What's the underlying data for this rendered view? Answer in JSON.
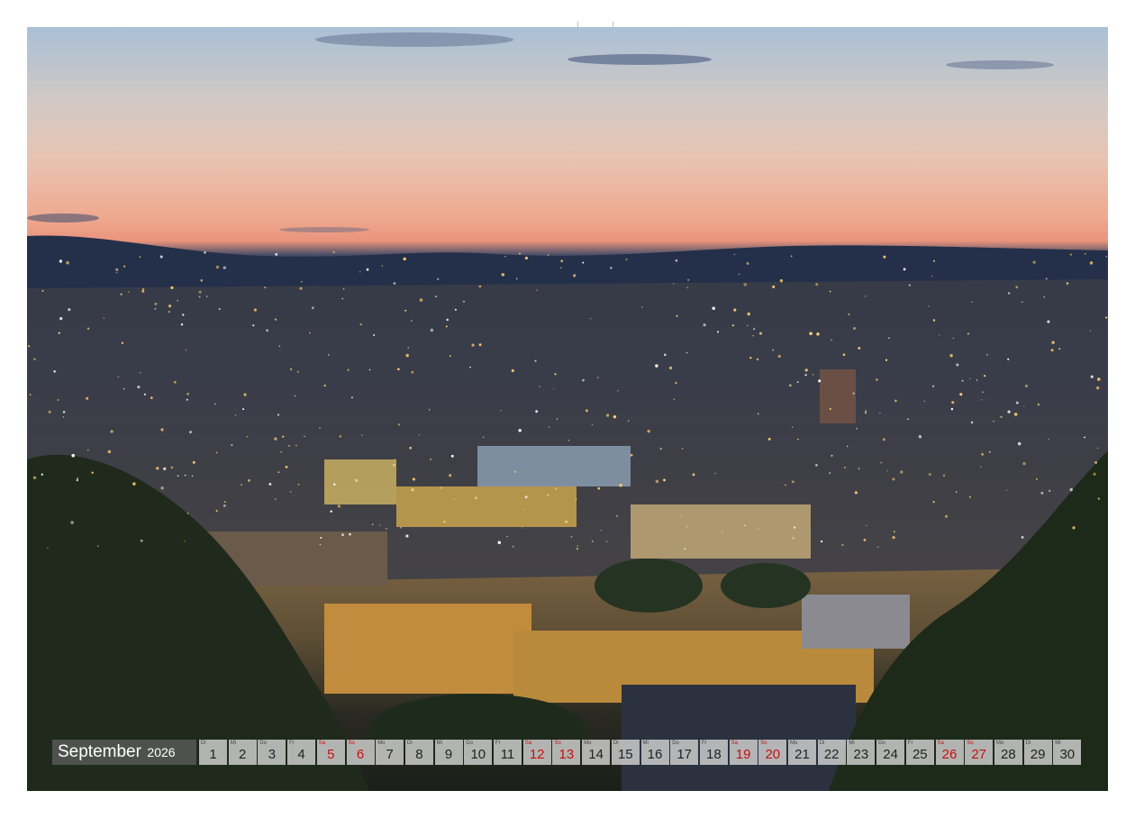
{
  "calendar": {
    "month": "September",
    "year": "2026",
    "days": [
      {
        "wd": "Di",
        "n": "1",
        "red": false
      },
      {
        "wd": "Mi",
        "n": "2",
        "red": false
      },
      {
        "wd": "Do",
        "n": "3",
        "red": false
      },
      {
        "wd": "Fr",
        "n": "4",
        "red": false
      },
      {
        "wd": "Sa",
        "n": "5",
        "red": true
      },
      {
        "wd": "So",
        "n": "6",
        "red": true
      },
      {
        "wd": "Mo",
        "n": "7",
        "red": false
      },
      {
        "wd": "Di",
        "n": "8",
        "red": false
      },
      {
        "wd": "Mi",
        "n": "9",
        "red": false
      },
      {
        "wd": "Do",
        "n": "10",
        "red": false
      },
      {
        "wd": "Fr",
        "n": "11",
        "red": false
      },
      {
        "wd": "Sa",
        "n": "12",
        "red": true
      },
      {
        "wd": "So",
        "n": "13",
        "red": true
      },
      {
        "wd": "Mo",
        "n": "14",
        "red": false
      },
      {
        "wd": "Di",
        "n": "15",
        "red": false
      },
      {
        "wd": "Mi",
        "n": "16",
        "red": false
      },
      {
        "wd": "Do",
        "n": "17",
        "red": false
      },
      {
        "wd": "Fr",
        "n": "18",
        "red": false
      },
      {
        "wd": "Sa",
        "n": "19",
        "red": true
      },
      {
        "wd": "So",
        "n": "20",
        "red": true
      },
      {
        "wd": "Mo",
        "n": "21",
        "red": false
      },
      {
        "wd": "Di",
        "n": "22",
        "red": false
      },
      {
        "wd": "Mi",
        "n": "23",
        "red": false
      },
      {
        "wd": "Do",
        "n": "24",
        "red": false
      },
      {
        "wd": "Fr",
        "n": "25",
        "red": false
      },
      {
        "wd": "Sa",
        "n": "26",
        "red": true
      },
      {
        "wd": "So",
        "n": "27",
        "red": true
      },
      {
        "wd": "Mo",
        "n": "28",
        "red": false
      },
      {
        "wd": "Di",
        "n": "29",
        "red": false
      },
      {
        "wd": "Mi",
        "n": "30",
        "red": false
      }
    ]
  },
  "colors": {
    "weekend": "#c81010",
    "strip_bg": "#5a5a5a",
    "day_bg": "#cdcdcd"
  }
}
